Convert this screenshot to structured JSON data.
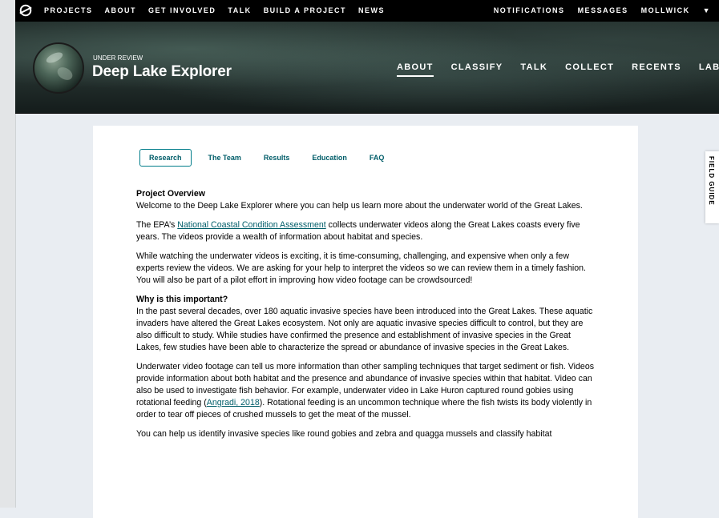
{
  "topnav": {
    "logo_icon": "zooniverse-logo-icon",
    "links": [
      "PROJECTS",
      "ABOUT",
      "GET INVOLVED",
      "TALK",
      "BUILD A PROJECT",
      "NEWS"
    ],
    "notifications": "NOTIFICATIONS",
    "messages": "MESSAGES",
    "user": "MOLLWICK"
  },
  "hero": {
    "status": "UNDER REVIEW",
    "title": "Deep Lake Explorer",
    "nav": [
      "ABOUT",
      "CLASSIFY",
      "TALK",
      "COLLECT",
      "RECENTS",
      "LAB"
    ],
    "active_nav": "ABOUT"
  },
  "field_guide": {
    "label": "FIELD GUIDE"
  },
  "about": {
    "tabs": [
      "Research",
      "The Team",
      "Results",
      "Education",
      "FAQ"
    ],
    "active_tab": "Research",
    "overview_heading": "Project Overview",
    "overview_p1": "Welcome to the Deep Lake Explorer where you can help us learn more about the underwater world of the Great Lakes.",
    "overview_p2_before": "The EPA’s ",
    "overview_p2_link": "National Coastal Condition Assessment",
    "overview_p2_after": " collects underwater videos along the Great Lakes coasts every five years. The videos provide a wealth of information about habitat and species.",
    "overview_p3": "While watching the underwater videos is exciting, it is time-consuming, challenging, and expensive when only a few experts review the videos. We are asking for your help to interpret the videos so we can review them in a timely fashion. You will also be part of a pilot effort in improving how video footage can be crowdsourced!",
    "why_heading": "Why is this important?",
    "why_p1": "In the past several decades, over 180 aquatic invasive species have been introduced into the Great Lakes. These aquatic invaders have altered the Great Lakes ecosystem. Not only are aquatic invasive species difficult to control, but they are also difficult to study. While studies have confirmed the presence and establishment of invasive species in the Great Lakes, few studies have been able to characterize the spread or abundance of invasive species in the Great Lakes.",
    "why_p2_before": "Underwater video footage can tell us more information than other sampling techniques that target sediment or fish. Videos provide information about both habitat and the presence and abundance of invasive species within that habitat. Video can also be used to investigate fish behavior. For example, underwater video in Lake Huron captured round gobies using rotational feeding (",
    "why_p2_link": "Angradi, 2018",
    "why_p2_after": "). Rotational feeding is an uncommon technique where the fish twists its body violently in order to tear off pieces of crushed mussels to get the meat of the mussel.",
    "why_p3": "You can help us identify invasive species like round gobies and zebra and quagga mussels and classify habitat"
  }
}
